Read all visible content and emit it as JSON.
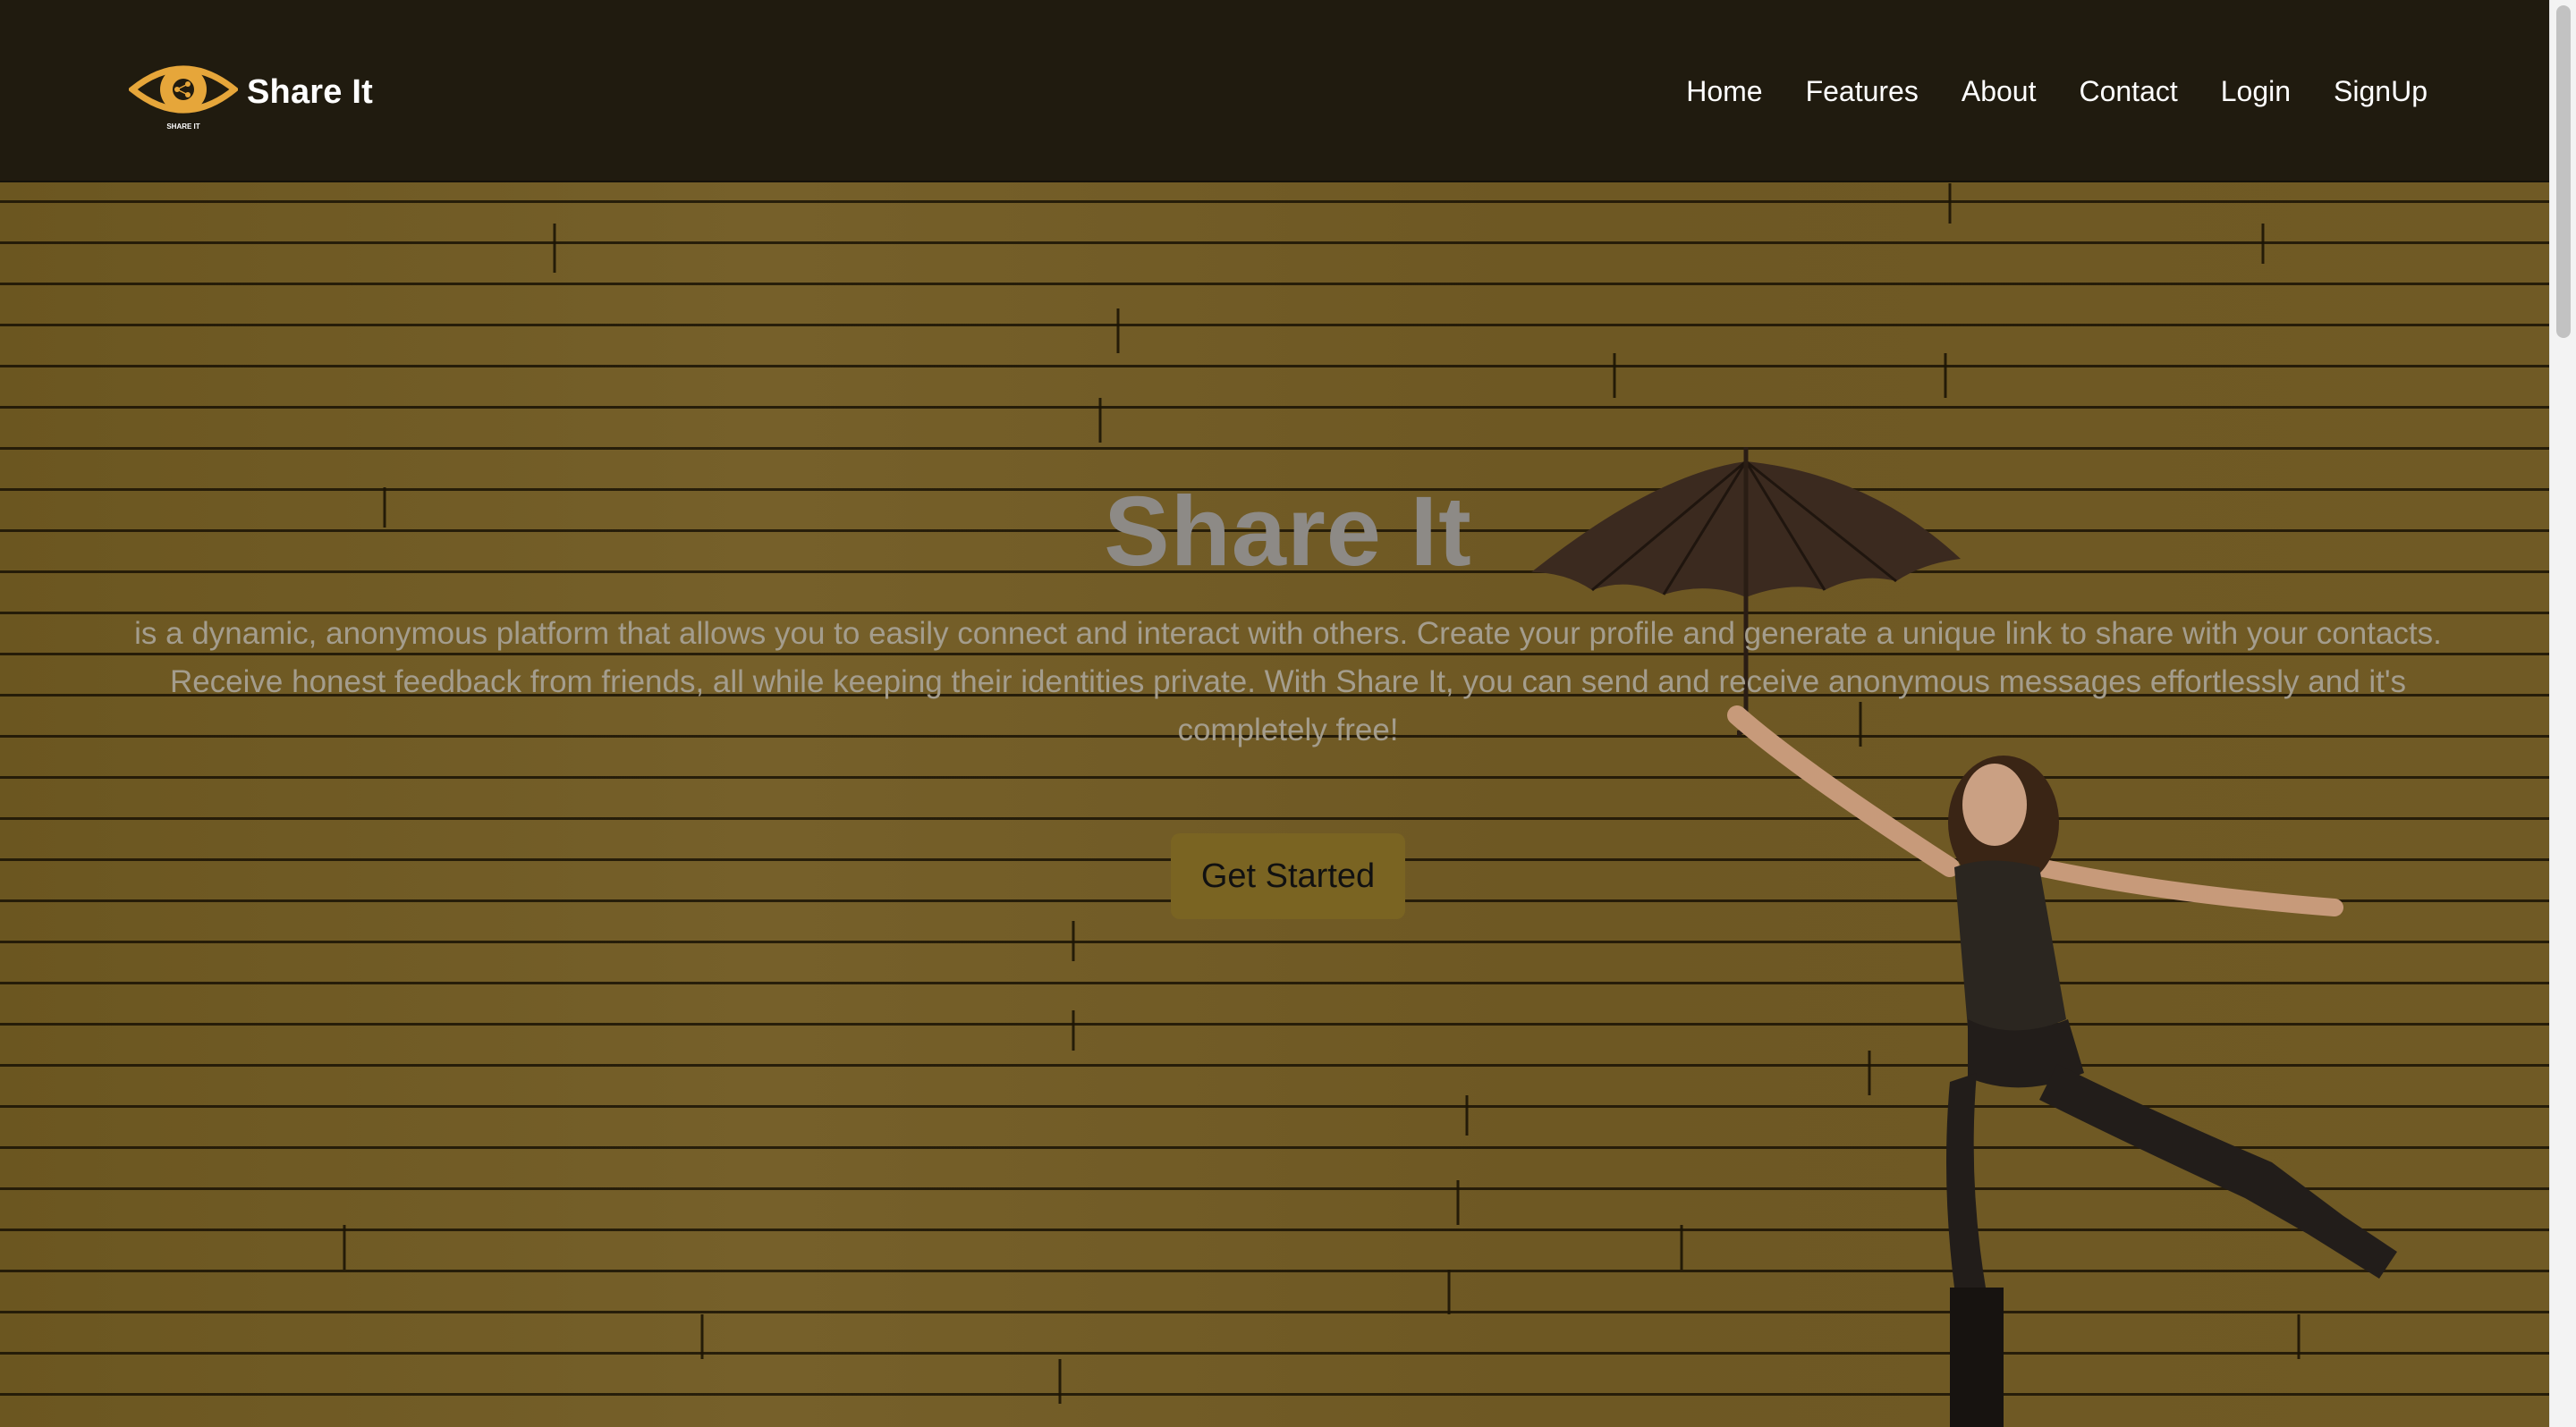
{
  "brand": {
    "name": "Share It",
    "logo_icon": "eye-share-logo-icon",
    "logo_caption": "SHARE IT",
    "logo_color": "#e6a63a"
  },
  "nav": {
    "items": [
      {
        "label": "Home"
      },
      {
        "label": "Features"
      },
      {
        "label": "About"
      },
      {
        "label": "Contact"
      },
      {
        "label": "Login"
      },
      {
        "label": "SignUp"
      }
    ]
  },
  "hero": {
    "title": "Share It",
    "line1": "is a dynamic, anonymous platform that allows you to easily connect and interact with others. Create your profile and generate a unique link to share with your contacts.",
    "line2": "Receive honest feedback from friends, all while keeping their identities private. With Share It, you can send and receive anonymous messages effortlessly and it's completely free!",
    "cta_label": "Get Started",
    "cta_color": "#7a6422",
    "background_color": "#6f5a22"
  }
}
